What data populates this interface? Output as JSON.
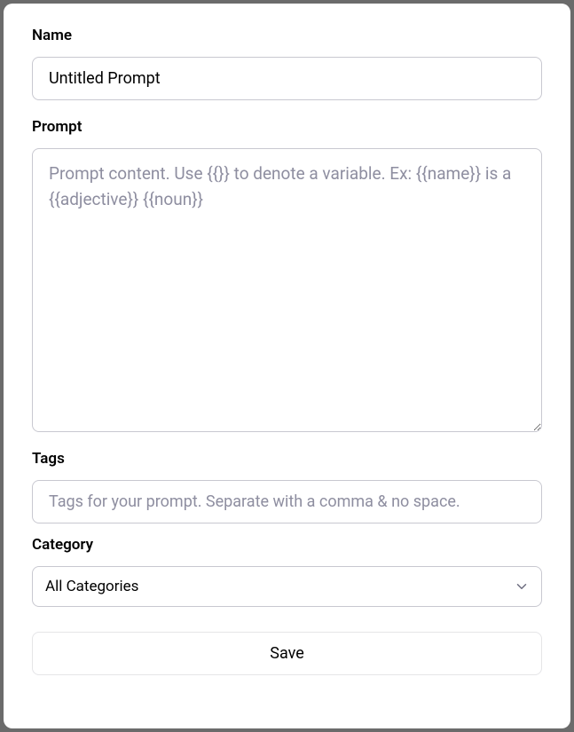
{
  "form": {
    "name": {
      "label": "Name",
      "value": "Untitled Prompt"
    },
    "prompt": {
      "label": "Prompt",
      "placeholder": "Prompt content. Use {{}} to denote a variable. Ex: {{name}} is a {{adjective}} {{noun}}",
      "value": ""
    },
    "tags": {
      "label": "Tags",
      "placeholder": "Tags for your prompt. Separate with a comma & no space.",
      "value": ""
    },
    "category": {
      "label": "Category",
      "selected": "All Categories"
    },
    "save_label": "Save"
  }
}
